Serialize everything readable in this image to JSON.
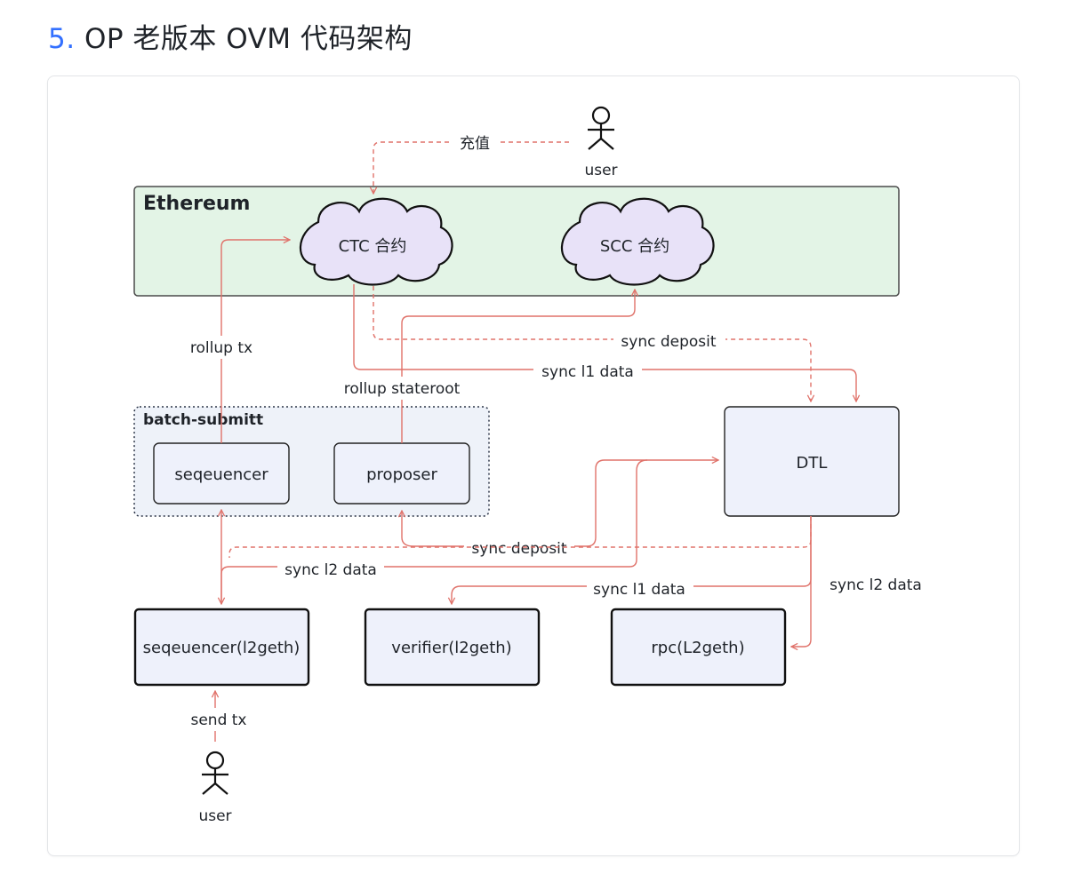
{
  "section": {
    "number": "5.",
    "title": "OP 老版本 OVM 代码架构"
  },
  "diagram": {
    "groups": {
      "ethereum": "Ethereum",
      "batch": "batch-submitt"
    },
    "nodes": {
      "ctc": "CTC 合约",
      "scc": "SCC 合约",
      "sequencer_batch": "seqeuencer",
      "proposer": "proposer",
      "dtl": "DTL",
      "sequencer_l2geth": "seqeuencer(l2geth)",
      "verifier": "verifier(l2geth)",
      "rpc": "rpc(L2geth)"
    },
    "actors": {
      "top_user": "user",
      "bottom_user": "user"
    },
    "edge_labels": {
      "recharge": "充值",
      "rollup_tx": "rollup tx",
      "sync_deposit_top": "sync deposit",
      "sync_l1_data_top": "sync l1 data",
      "rollup_stateroot": "rollup stateroot",
      "sync_deposit_mid": "sync deposit",
      "sync_l2_data_mid": "sync l2 data",
      "sync_l1_data_low": "sync l1 data",
      "sync_l2_data_right": "sync l2 data",
      "send_tx": "send tx"
    },
    "colors": {
      "edge": "#e0726a",
      "ethereum_fill": "#e3f4e6",
      "cloud_fill": "#e8e2f8",
      "node_fill": "#eef1fb",
      "batch_fill": "#eef2f9"
    }
  }
}
